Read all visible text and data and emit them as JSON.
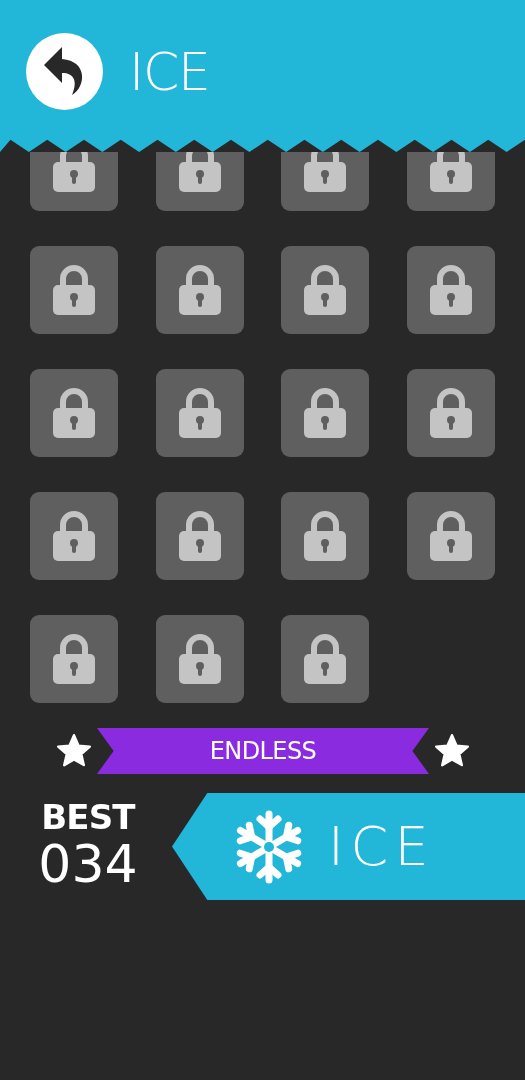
{
  "header": {
    "title": "ICE"
  },
  "levels": [
    {
      "locked": true
    },
    {
      "locked": true
    },
    {
      "locked": true
    },
    {
      "locked": true
    },
    {
      "locked": true
    },
    {
      "locked": true
    },
    {
      "locked": true
    },
    {
      "locked": true
    },
    {
      "locked": true
    },
    {
      "locked": true
    },
    {
      "locked": true
    },
    {
      "locked": true
    },
    {
      "locked": true
    },
    {
      "locked": true
    },
    {
      "locked": true
    },
    {
      "locked": true
    },
    {
      "locked": true
    },
    {
      "locked": true
    },
    {
      "locked": true
    }
  ],
  "endless": {
    "label": "ENDLESS",
    "best_label": "BEST",
    "best_score": "034",
    "mode": "ICE"
  }
}
